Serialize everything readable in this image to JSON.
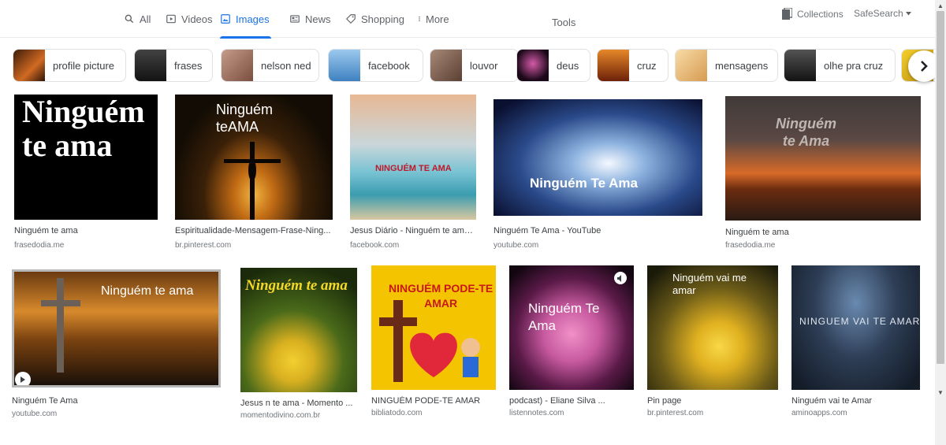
{
  "tabs": [
    {
      "label": "All",
      "icon": "search-icon"
    },
    {
      "label": "Videos",
      "icon": "play-icon"
    },
    {
      "label": "Images",
      "icon": "image-icon",
      "active": true
    },
    {
      "label": "News",
      "icon": "news-icon"
    },
    {
      "label": "Shopping",
      "icon": "tag-icon"
    },
    {
      "label": "More",
      "icon": "more-vert-icon"
    }
  ],
  "tools_label": "Tools",
  "collections_label": "Collections",
  "safesearch_label": "SafeSearch",
  "chips": [
    {
      "label": "profile picture",
      "thumb": "#7a3d16"
    },
    {
      "label": "frases",
      "thumb": "#2b2b2b"
    },
    {
      "label": "nelson ned",
      "thumb": "#a47964"
    },
    {
      "label": "facebook",
      "thumb": "#6fa5d6"
    },
    {
      "label": "louvor",
      "thumb": "#8d6e63"
    },
    {
      "label": "deus",
      "thumb": "#2a1a2e"
    },
    {
      "label": "cruz",
      "thumb": "#c0541c"
    },
    {
      "label": "mensagens",
      "thumb": "#efc48a"
    },
    {
      "label": "olhe pra cruz",
      "thumb": "#3a3a3a"
    },
    {
      "label": "",
      "thumb": "#e6c21a"
    }
  ],
  "results": [
    {
      "title": "Ninguém te ama",
      "source": "frasedodia.me",
      "caption": "Ninguém\nte ama",
      "colors": [
        "#000000",
        "#0a0a0a"
      ]
    },
    {
      "title": "Espiritualidade-Mensagem-Frase-Ning...",
      "source": "br.pinterest.com",
      "caption": "Ninguém\nteAMA",
      "colors": [
        "#1a1208",
        "#e0a030"
      ]
    },
    {
      "title": "Jesus Diário - Ninguém te ama...",
      "source": "facebook.com",
      "caption": "NINGUÉM TE AMA",
      "colors": [
        "#f0c8a8",
        "#5bb8c8"
      ]
    },
    {
      "title": "Ninguém Te Ama - YouTube",
      "source": "youtube.com",
      "caption": "Ninguém Te Ama",
      "colors": [
        "#0a1535",
        "#d8e6f4"
      ]
    },
    {
      "title": "Ninguém te ama",
      "source": "frasedodia.me",
      "caption": "Ninguém\nte Ama",
      "colors": [
        "#3b2a26",
        "#d66a2a"
      ]
    },
    {
      "title": "Ninguém Te Ama",
      "source": "youtube.com",
      "caption": "Ninguém te ama",
      "colors": [
        "#2a1606",
        "#d88a2c"
      ]
    },
    {
      "title": "Jesus  n  te ama - Momento ...",
      "source": "momentodivino.com.br",
      "caption": "Ninguém te ama",
      "colors": [
        "#213a10",
        "#ecd01e"
      ]
    },
    {
      "title": "NINGUÉM PODE-TE AMAR",
      "source": "bibliatodo.com",
      "caption": "NINGUÉM PODE-TE\nAMAR",
      "colors": [
        "#f5c400",
        "#e8a800"
      ]
    },
    {
      "title": "podcast) - Eliane Silva ...",
      "source": "listennotes.com",
      "caption": "Ninguém Te\nAma",
      "colors": [
        "#1a0818",
        "#e36ab3"
      ]
    },
    {
      "title": "Pin page",
      "source": "br.pinterest.com",
      "caption": "Ninguém vai me\namar",
      "colors": [
        "#2a2a10",
        "#e8c020"
      ]
    },
    {
      "title": "Ninguém vai te Amar",
      "source": "aminoapps.com",
      "caption": "NINGUEM VAI TE AMAR",
      "colors": [
        "#1e2a3c",
        "#3c5a7a"
      ]
    }
  ],
  "colors": {
    "accent": "#1a73e8",
    "chip_border": "#dfe1e5",
    "source_text": "#70757a"
  }
}
